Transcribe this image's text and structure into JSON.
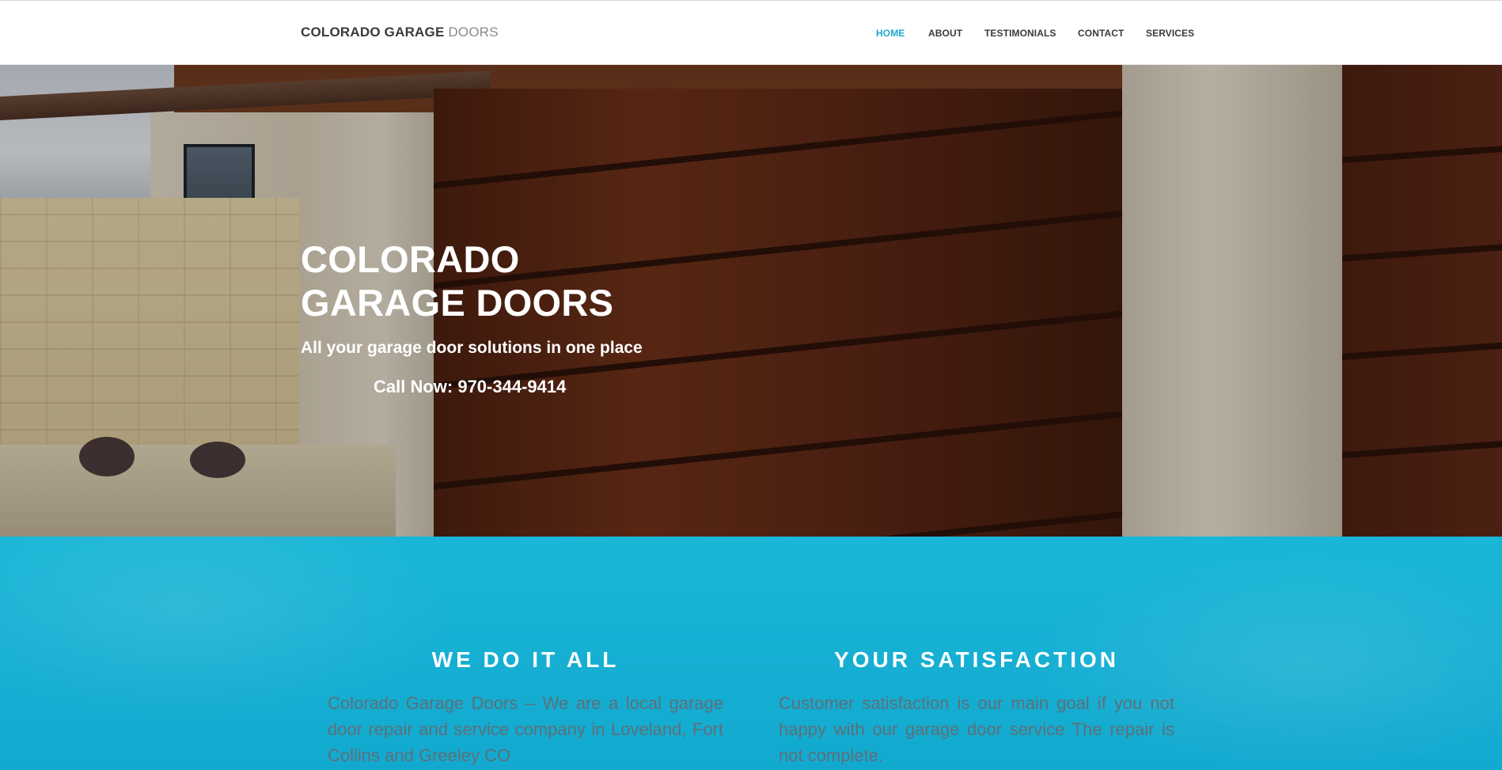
{
  "header": {
    "logo_strong": "COLORADO GARAGE",
    "logo_light": "DOORS",
    "nav": [
      {
        "label": "HOME",
        "active": true
      },
      {
        "label": "ABOUT",
        "active": false
      },
      {
        "label": "TESTIMONIALS",
        "active": false
      },
      {
        "label": "CONTACT",
        "active": false
      },
      {
        "label": "SERVICES",
        "active": false
      }
    ]
  },
  "hero": {
    "title_line1": "COLORADO",
    "title_line2": "GARAGE DOORS",
    "subtitle": "All your garage door solutions in one place",
    "call": "Call Now: 970-344-9414"
  },
  "features": [
    {
      "title": "WE DO IT ALL",
      "text": "Colorado Garage Doors – We are a local garage door repair and service company in Loveland, Fort Collins and Greeley CO"
    },
    {
      "title": "YOUR SATISFACTION",
      "text": "Customer satisfaction is our main goal if you not happy with our garage door service The repair is not complete."
    }
  ],
  "colors": {
    "accent": "#1ea8cc",
    "band": "#1ab6d7",
    "text_dark": "#3a3a3a",
    "feature_text": "#5f6f78"
  }
}
